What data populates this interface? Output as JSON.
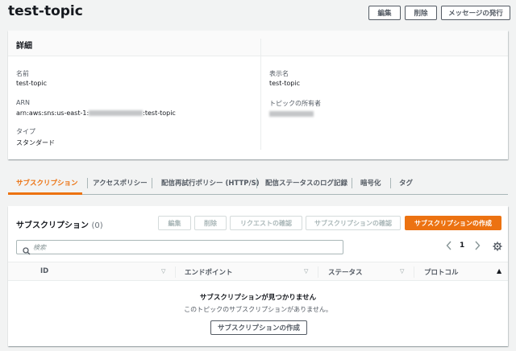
{
  "page": {
    "title": "test-topic"
  },
  "header_buttons": {
    "edit": "編集",
    "delete": "削除",
    "publish": "メッセージの発行"
  },
  "details": {
    "heading": "詳細",
    "name_label": "名前",
    "name_value": "test-topic",
    "arn_label": "ARN",
    "arn_prefix": "arn:aws:sns:us-east-1:",
    "arn_suffix": ":test-topic",
    "type_label": "タイプ",
    "type_value": "スタンダード",
    "display_name_label": "表示名",
    "display_name_value": "test-topic",
    "owner_label": "トピックの所有者"
  },
  "tabs": [
    {
      "label": "サブスクリプション",
      "active": true
    },
    {
      "label": "アクセスポリシー"
    },
    {
      "label": "配信再試行ポリシー (HTTP/S)"
    },
    {
      "label": "配信ステータスのログ記録"
    },
    {
      "label": "暗号化"
    },
    {
      "label": "タグ"
    }
  ],
  "subscriptions": {
    "heading": "サブスクリプション",
    "count": "(0)",
    "buttons": {
      "edit": "編集",
      "delete": "削除",
      "request_confirm": "リクエストの確認",
      "confirm_subscription": "サブスクリプションの確認",
      "create": "サブスクリプションの作成"
    },
    "search_placeholder": "検索",
    "page_number": "1",
    "columns": [
      "ID",
      "エンドポイント",
      "ステータス",
      "プロトコル"
    ],
    "empty_title": "サブスクリプションが見つかりません",
    "empty_sub": "このトピックのサブスクリプションがありません。",
    "empty_create": "サブスクリプションの作成"
  },
  "colors": {
    "accent": "#ec7211",
    "text": "#16191f",
    "muted": "#545b64",
    "background": "#f2f3f3"
  },
  "icons": [
    "search-icon",
    "chevron-left-icon",
    "chevron-right-icon",
    "gear-icon",
    "sort-icon",
    "sort-ascending-icon"
  ]
}
